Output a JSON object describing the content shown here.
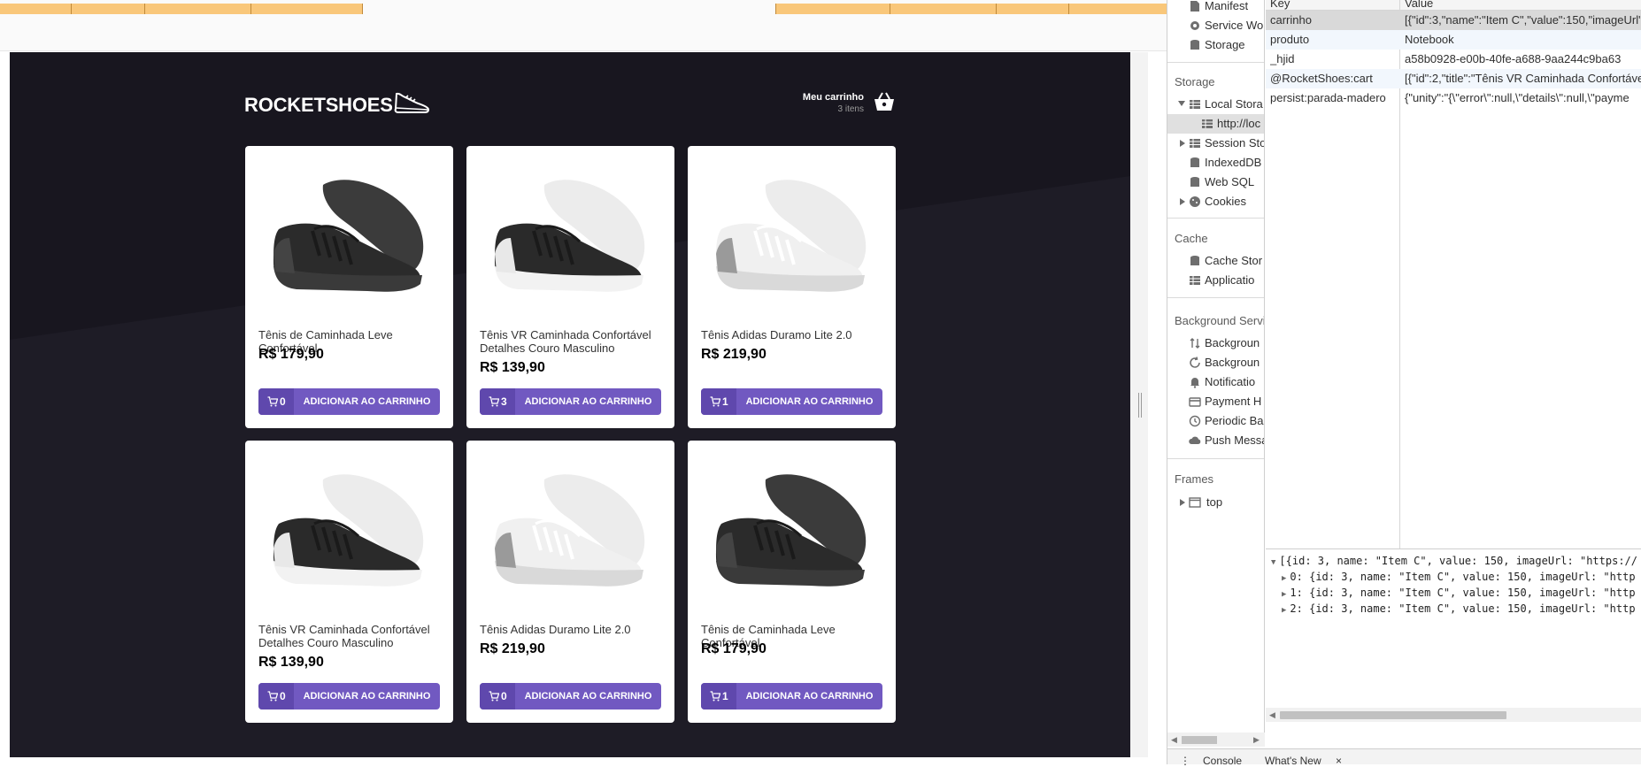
{
  "app": {
    "logo": "ROCKETSHOES",
    "cart_title": "Meu carrinho",
    "cart_count": "3 itens",
    "button_label": "ADICIONAR AO CARRINHO"
  },
  "products": [
    {
      "title": "Tênis de Caminhada Leve Confortável",
      "price": "R$ 179,90",
      "amount": "0",
      "variant": "dark"
    },
    {
      "title": "Tênis VR Caminhada Confortável Detalhes Couro Masculino",
      "price": "R$ 139,90",
      "amount": "3",
      "variant": "mixed"
    },
    {
      "title": "Tênis Adidas Duramo Lite 2.0",
      "price": "R$ 219,90",
      "amount": "1",
      "variant": "white"
    },
    {
      "title": "Tênis VR Caminhada Confortável Detalhes Couro Masculino",
      "price": "R$ 139,90",
      "amount": "0",
      "variant": "mixed"
    },
    {
      "title": "Tênis Adidas Duramo Lite 2.0",
      "price": "R$ 219,90",
      "amount": "0",
      "variant": "white"
    },
    {
      "title": "Tênis de Caminhada Leve Confortável",
      "price": "R$ 179,90",
      "amount": "1",
      "variant": "dark"
    }
  ],
  "devtools": {
    "sidebar": {
      "manifest": "Manifest",
      "service_workers": "Service Wo",
      "storage_item": "Storage",
      "storage_section": "Storage",
      "local_storage": "Local Stora",
      "local_origin": "http://loc",
      "session_storage": "Session Sto",
      "indexeddb": "IndexedDB",
      "websql": "Web SQL",
      "cookies": "Cookies",
      "cache_section": "Cache",
      "cache_storage": "Cache Stor",
      "app_cache": "Applicatio",
      "bg_section": "Background Servi",
      "bg_fetch": "Backgroun",
      "bg_sync": "Backgroun",
      "notifications": "Notificatio",
      "payment": "Payment H",
      "periodic": "Periodic Ba",
      "push": "Push Messa",
      "frames_section": "Frames",
      "top": "top"
    },
    "table": {
      "key_header": "Key",
      "value_header": "Value",
      "rows": [
        {
          "key": "carrinho",
          "value": "[{\"id\":3,\"name\":\"Item C\",\"value\":150,\"imageUrl\""
        },
        {
          "key": "produto",
          "value": "Notebook"
        },
        {
          "key": "_hjid",
          "value": "a58b0928-e00b-40fe-a688-9aa244c9ba63"
        },
        {
          "key": "@RocketShoes:cart",
          "value": "[{\"id\":2,\"title\":\"Tênis VR Caminhada Confortáve"
        },
        {
          "key": "persist:parada-madero",
          "value": "{\"unity\":\"{\\\"error\\\":null,\\\"details\\\":null,\\\"payme"
        }
      ]
    },
    "preview": [
      "[{id: 3, name: \"Item C\", value: 150, imageUrl: \"https://",
      "0: {id: 3, name: \"Item C\", value: 150, imageUrl: \"http",
      "1: {id: 3, name: \"Item C\", value: 150, imageUrl: \"http",
      "2: {id: 3, name: \"Item C\", value: 150, imageUrl: \"http"
    ],
    "drawer": {
      "console": "Console",
      "whats_new": "What's New"
    }
  },
  "colors": {
    "accent": "#7159c1",
    "accent_dark": "#5f48ad",
    "app_bg": "#18161f",
    "timeline": "#f9c77a"
  }
}
